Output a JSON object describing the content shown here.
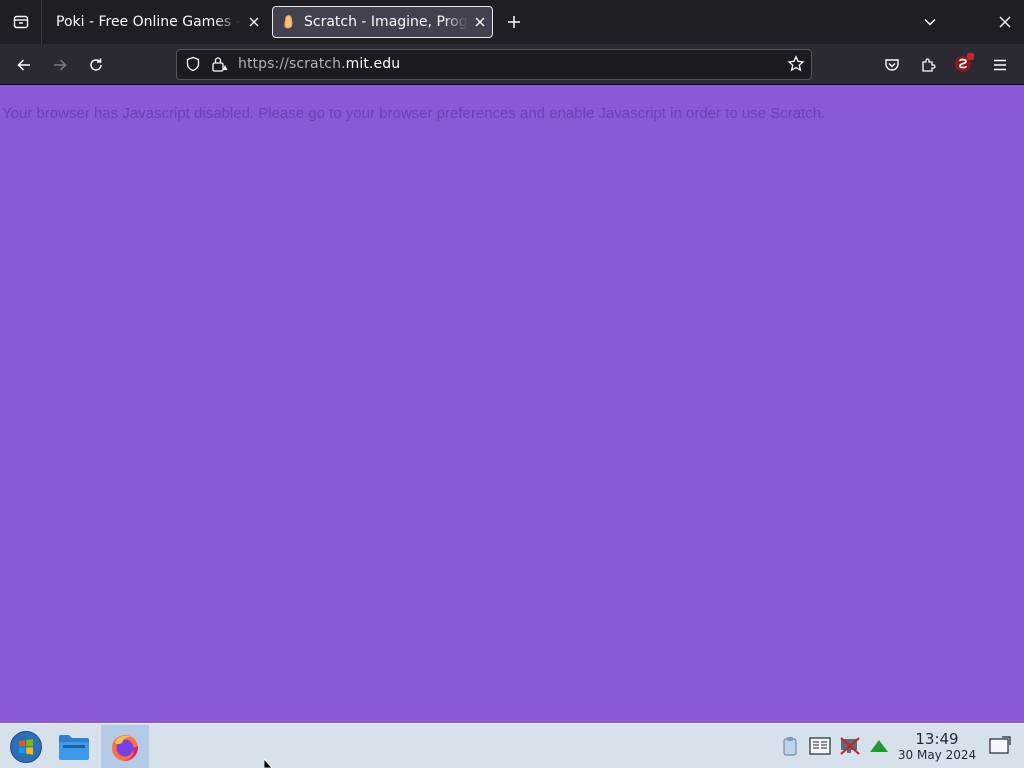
{
  "browser": {
    "tabs": [
      {
        "title": "Poki - Free Online Games - Play Now!",
        "active": false
      },
      {
        "title": "Scratch - Imagine, Program, Share",
        "active": true
      }
    ],
    "url_prefix": "https://scratch.",
    "url_domain": "mit.edu"
  },
  "page": {
    "message": "Your browser has Javascript disabled. Please go to your browser preferences and enable Javascript in order to use Scratch.",
    "background_color": "#885ad8"
  },
  "taskbar": {
    "clock_time": "13:49",
    "clock_date": "30 May 2024"
  }
}
